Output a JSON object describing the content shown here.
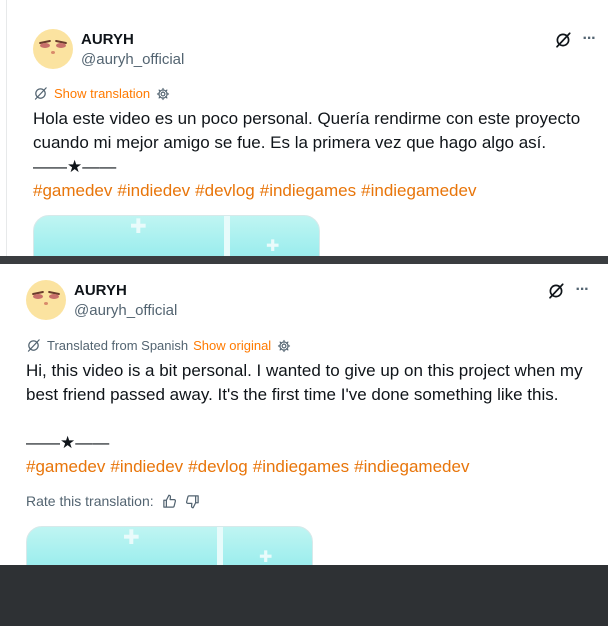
{
  "colors": {
    "accent": "#ff7a00",
    "hashtag": "#e8750a",
    "divider": "#3a3d40",
    "secondary_text": "#536471"
  },
  "original_post": {
    "author_name": "AURYH",
    "author_handle": "@auryh_official",
    "show_translation_label": "Show translation",
    "text": "Hola este video es un poco personal. Quería rendirme con este proyecto cuando mi mejor amigo se fue. Es la primera vez que hago algo así.",
    "ornament": "——★——",
    "hashtags": [
      "#gamedev",
      "#indiedev",
      "#devlog",
      "#indiegames",
      "#indiegamedev"
    ],
    "icons": [
      "grok-icon",
      "more-icon",
      "translate-icon",
      "settings-icon"
    ]
  },
  "translated_post": {
    "author_name": "AURYH",
    "author_handle": "@auryh_official",
    "translated_from_label": "Translated from Spanish",
    "show_original_label": "Show original",
    "text": "Hi, this video is a bit personal. I wanted to give up on this project when my best friend passed away. It's the first time I've done something like this.",
    "ornament": "——★——",
    "hashtags": [
      "#gamedev",
      "#indiedev",
      "#devlog",
      "#indiegames",
      "#indiegamedev"
    ],
    "rate_label": "Rate this translation:",
    "icons": [
      "grok-icon",
      "more-icon",
      "translate-icon",
      "settings-icon",
      "thumbs-up-icon",
      "thumbs-down-icon"
    ]
  }
}
